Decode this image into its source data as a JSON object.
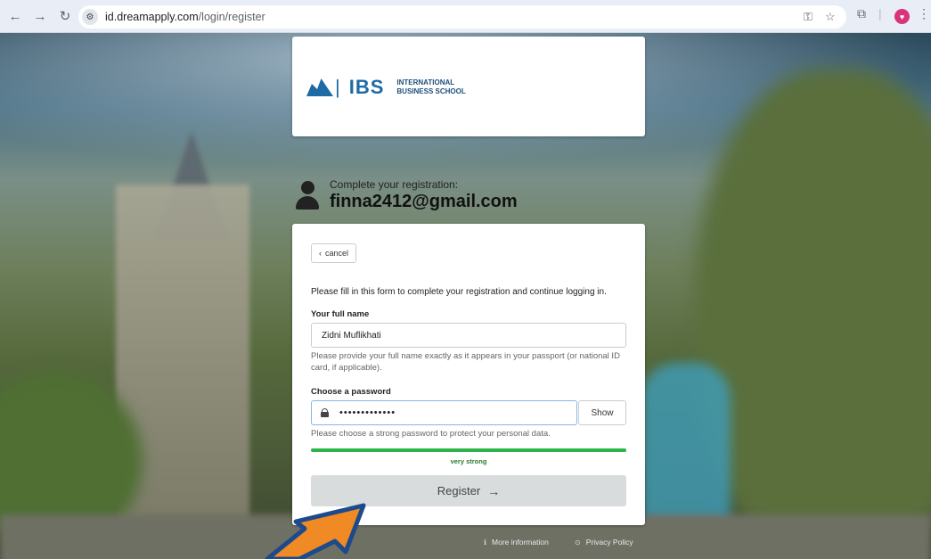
{
  "browser": {
    "url_host": "id.dreamapply.com",
    "url_path": "/login/register"
  },
  "logo": {
    "brand": "IBS",
    "line1": "INTERNATIONAL",
    "line2": "BUSINESS SCHOOL"
  },
  "user": {
    "subtitle": "Complete your registration:",
    "email": "finna2412@gmail.com"
  },
  "form": {
    "cancel_label": "cancel",
    "intro": "Please fill in this form to complete your registration and continue logging in.",
    "name_label": "Your full name",
    "name_value": "Zidni Muflikhati",
    "name_help": "Please provide your full name exactly as it appears in your passport (or national ID card, if applicable).",
    "password_label": "Choose a password",
    "password_value": "•••••••••••••",
    "show_label": "Show",
    "password_help": "Please choose a strong password to protect your personal data.",
    "strength_label": "very strong",
    "strength_fraction": 1.0,
    "strength_color": "#2db34a",
    "register_label": "Register"
  },
  "footer": {
    "more_info": "More information",
    "privacy": "Privacy Policy"
  },
  "icons": {
    "back": "arrow-left-icon",
    "forward": "arrow-right-icon",
    "reload": "reload-icon",
    "key": "key-icon",
    "star": "star-icon",
    "extensions": "puzzle-icon",
    "menu": "kebab-menu-icon"
  }
}
